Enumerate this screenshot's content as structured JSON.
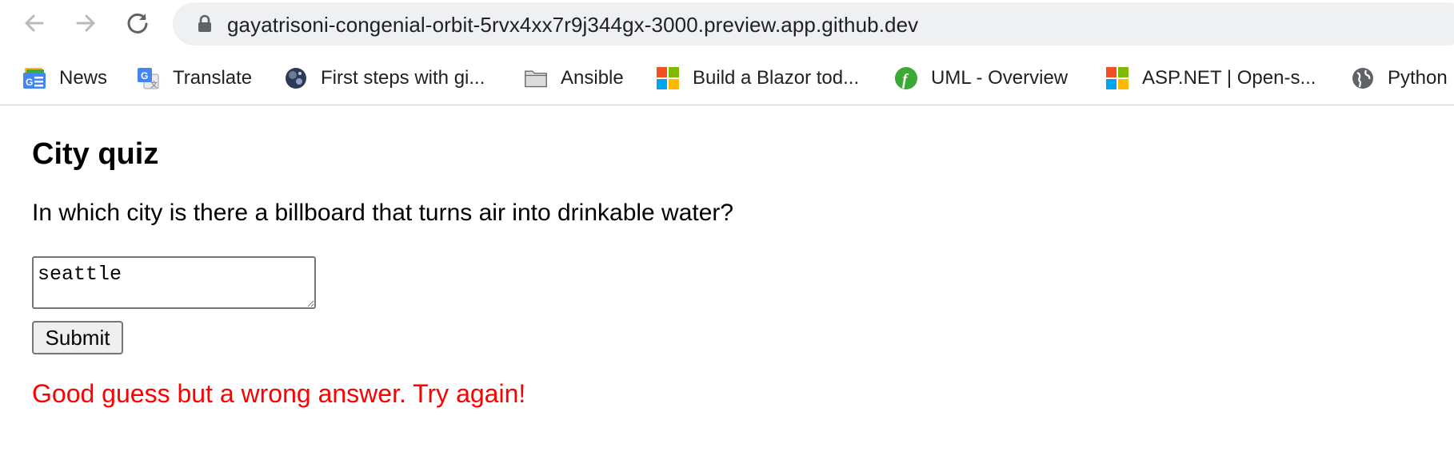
{
  "browser": {
    "url": "gayatrisoni-congenial-orbit-5rvx4xx7r9j344gx-3000.preview.app.github.dev",
    "bookmarks": [
      {
        "label": "News",
        "icon": "google-news-icon"
      },
      {
        "label": "Translate",
        "icon": "google-translate-icon"
      },
      {
        "label": "First steps with gi...",
        "icon": "globe-avatar-icon"
      },
      {
        "label": "Ansible",
        "icon": "folder-icon"
      },
      {
        "label": "Build a Blazor tod...",
        "icon": "microsoft-logo-icon"
      },
      {
        "label": "UML - Overview",
        "icon": "uml-green-icon"
      },
      {
        "label": "ASP.NET | Open-s...",
        "icon": "microsoft-logo-icon"
      },
      {
        "label": "Python",
        "icon": "globe-icon"
      }
    ]
  },
  "quiz": {
    "title": "City quiz",
    "question": "In which city is there a billboard that turns air into drinkable water?",
    "answer_value": "seattle",
    "submit_label": "Submit",
    "feedback": "Good guess but a wrong answer. Try again!",
    "feedback_color": "#ff0000"
  }
}
